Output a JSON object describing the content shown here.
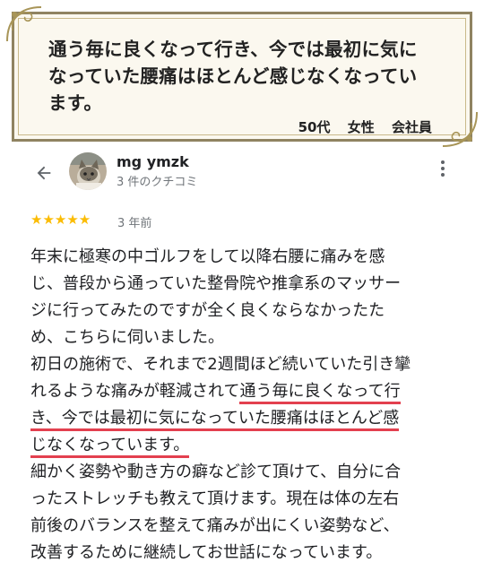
{
  "testimonial": {
    "quote_lines": [
      "通う毎に良くなって行き、今では最初に気に",
      "なっていた腰痛はほとんど感じなくなってい",
      "ます。"
    ],
    "age": "50代",
    "gender": "女性",
    "occupation": "会社員"
  },
  "review": {
    "reviewer_name": "mg ymzk",
    "review_count": "3 件のクチコミ",
    "stars": "★★★★★",
    "rating": 5,
    "time_ago": "3 年前",
    "lines": [
      {
        "before": "年末に極寒の中ゴルフをして以降右腰に痛みを感",
        "hl": "",
        "after": ""
      },
      {
        "before": "じ、普段から通っていた整骨院や推拿系のマッサー",
        "hl": "",
        "after": ""
      },
      {
        "before": "ジに行ってみたのですが全く良くならなかったた",
        "hl": "",
        "after": ""
      },
      {
        "before": "め、こちらに伺いました。",
        "hl": "",
        "after": ""
      },
      {
        "before": "初日の施術で、それまで2週間ほど続いていた引き攣",
        "hl": "",
        "after": ""
      },
      {
        "before": "れるような痛みが軽減されて",
        "hl": "通う毎に良くなって行",
        "after": ""
      },
      {
        "before": "",
        "hl": "き、今では最初に気になっていた腰痛はほとんど感",
        "after": ""
      },
      {
        "before": "",
        "hl": "じなくなっています。",
        "after": ""
      },
      {
        "before": "細かく姿勢や動き方の癖など診て頂けて、自分に合",
        "hl": "",
        "after": ""
      },
      {
        "before": "ったストレッチも教えて頂けます。現在は体の左右",
        "hl": "",
        "after": ""
      },
      {
        "before": "前後のバランスを整えて痛みが出にくい姿勢など、",
        "hl": "",
        "after": ""
      },
      {
        "before": "改善するために継続してお世話になっています。",
        "hl": "",
        "after": ""
      }
    ]
  },
  "icons": {
    "back": "arrow-back-icon",
    "more": "more-vert-icon"
  },
  "colors": {
    "highlight_underline": "#e3404f",
    "star": "#fbbc04",
    "card_bg": "#fbf8ef",
    "card_border": "#8f8361"
  }
}
